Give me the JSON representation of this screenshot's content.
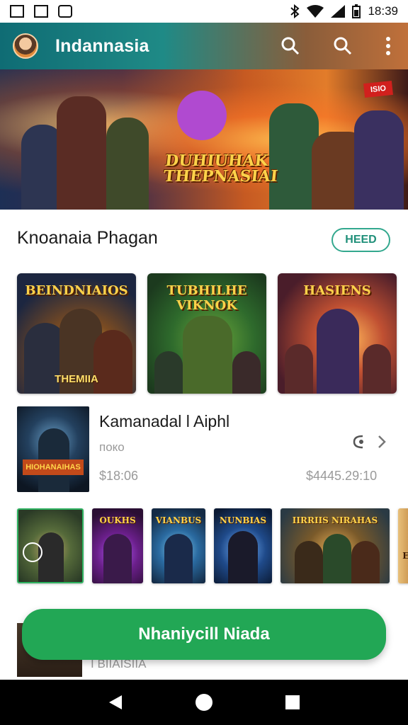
{
  "status_bar": {
    "time": "18:39",
    "icons": [
      "photo-icon",
      "image-icon",
      "battery-saver-icon",
      "bluetooth-icon",
      "wifi-icon",
      "signal-icon",
      "battery-icon"
    ]
  },
  "app_bar": {
    "title": "Indannasia",
    "actions": [
      "search-icon",
      "search-icon",
      "more-vert-icon"
    ]
  },
  "hero": {
    "title": "DUHIUHAK THEPNASIAI",
    "badge": "ISIO"
  },
  "section": {
    "title": "Knoanaia Phagan",
    "button_label": "HEED"
  },
  "cards": [
    {
      "title": "BEINDNIAIOS",
      "subtitle": "THEMIIA"
    },
    {
      "title": "TUBHILHE VIKNOK",
      "subtitle": ""
    },
    {
      "title": "HASIENS",
      "subtitle": ""
    }
  ],
  "feature": {
    "thumb_label": "HIOHANAIHAS",
    "title": "Kamanadal l Aiphl",
    "subtitle": "поко",
    "price": "$18:06",
    "price_alt": "$4445.29:10"
  },
  "thumbs": [
    {
      "title": ""
    },
    {
      "title": "OUKHS"
    },
    {
      "title": "VIANBUS"
    },
    {
      "title": "NUNBIAS"
    },
    {
      "title": "IIRRIIS NIRAHAS"
    },
    {
      "title": "Er"
    }
  ],
  "hidden_row": {
    "text": "I BIIAISIIA"
  },
  "cta": {
    "label": "Nhaniycill Niada"
  },
  "colors": {
    "accent_green": "#22a755",
    "outline_teal": "#33a88e",
    "app_bar_teal": "#0f6c74"
  }
}
